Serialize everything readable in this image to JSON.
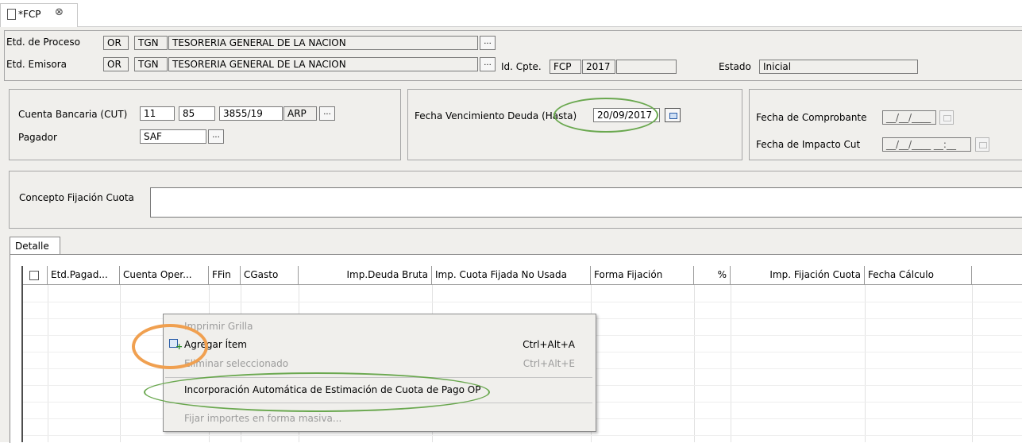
{
  "tab": {
    "title": "*FCP",
    "close_glyph": "⊗"
  },
  "header": {
    "etd_proceso_label": "Etd. de Proceso",
    "etd_proceso_code1": "OR",
    "etd_proceso_code2": "TGN",
    "etd_proceso_name": "TESORERIA GENERAL DE LA NACION",
    "etd_emisora_label": "Etd. Emisora",
    "etd_emisora_code1": "OR",
    "etd_emisora_code2": "TGN",
    "etd_emisora_name": "TESORERIA GENERAL DE LA NACION",
    "id_cpte_label": "Id. Cpte.",
    "id_cpte_type": "FCP",
    "id_cpte_year": "2017",
    "id_cpte_number": "",
    "estado_label": "Estado",
    "estado_value": "Inicial",
    "ellipsis": "..."
  },
  "cuenta": {
    "cuenta_label": "Cuenta Bancaria (CUT)",
    "cuenta_v1": "11",
    "cuenta_v2": "85",
    "cuenta_v3": "3855/19",
    "cuenta_v4": "ARP",
    "pagador_label": "Pagador",
    "pagador_value": "SAF",
    "ellipsis": "..."
  },
  "fecha_venc": {
    "label": "Fecha Vencimiento Deuda (Hasta)",
    "value": "20/09/2017"
  },
  "fechas": {
    "comprobante_label": "Fecha de Comprobante",
    "comprobante_value": "__/__/____",
    "impacto_label": "Fecha de Impacto Cut",
    "impacto_value": "__/__/____ __:__"
  },
  "concepto": {
    "label": "Concepto Fijación Cuota",
    "value": ""
  },
  "detalle": {
    "tab_label": "Detalle",
    "columns": [
      "Etd.Pagad...",
      "Cuenta Oper...",
      "FFin",
      "CGasto",
      "Imp.Deuda Bruta",
      "Imp. Cuota Fijada No Usada",
      "Forma Fijación",
      "%",
      "Imp. Fijación Cuota",
      "Fecha Cálculo"
    ]
  },
  "context_menu": {
    "items": [
      {
        "label": "Imprimir Grilla",
        "shortcut": "",
        "enabled": false
      },
      {
        "label": "Agregar Ítem",
        "shortcut": "Ctrl+Alt+A",
        "enabled": true
      },
      {
        "label": "Eliminar seleccionado",
        "shortcut": "Ctrl+Alt+E",
        "enabled": false
      },
      {
        "label": "Incorporación Automática de Estimación de Cuota de Pago OP",
        "shortcut": "",
        "enabled": true
      },
      {
        "label": "Fijar importes en forma masiva...",
        "shortcut": "",
        "enabled": false
      }
    ]
  },
  "colors": {
    "annotation_green": "#6aa84f",
    "annotation_orange": "#f0a050",
    "menu_bg": "#f0efec",
    "form_bg": "#f0efec"
  }
}
